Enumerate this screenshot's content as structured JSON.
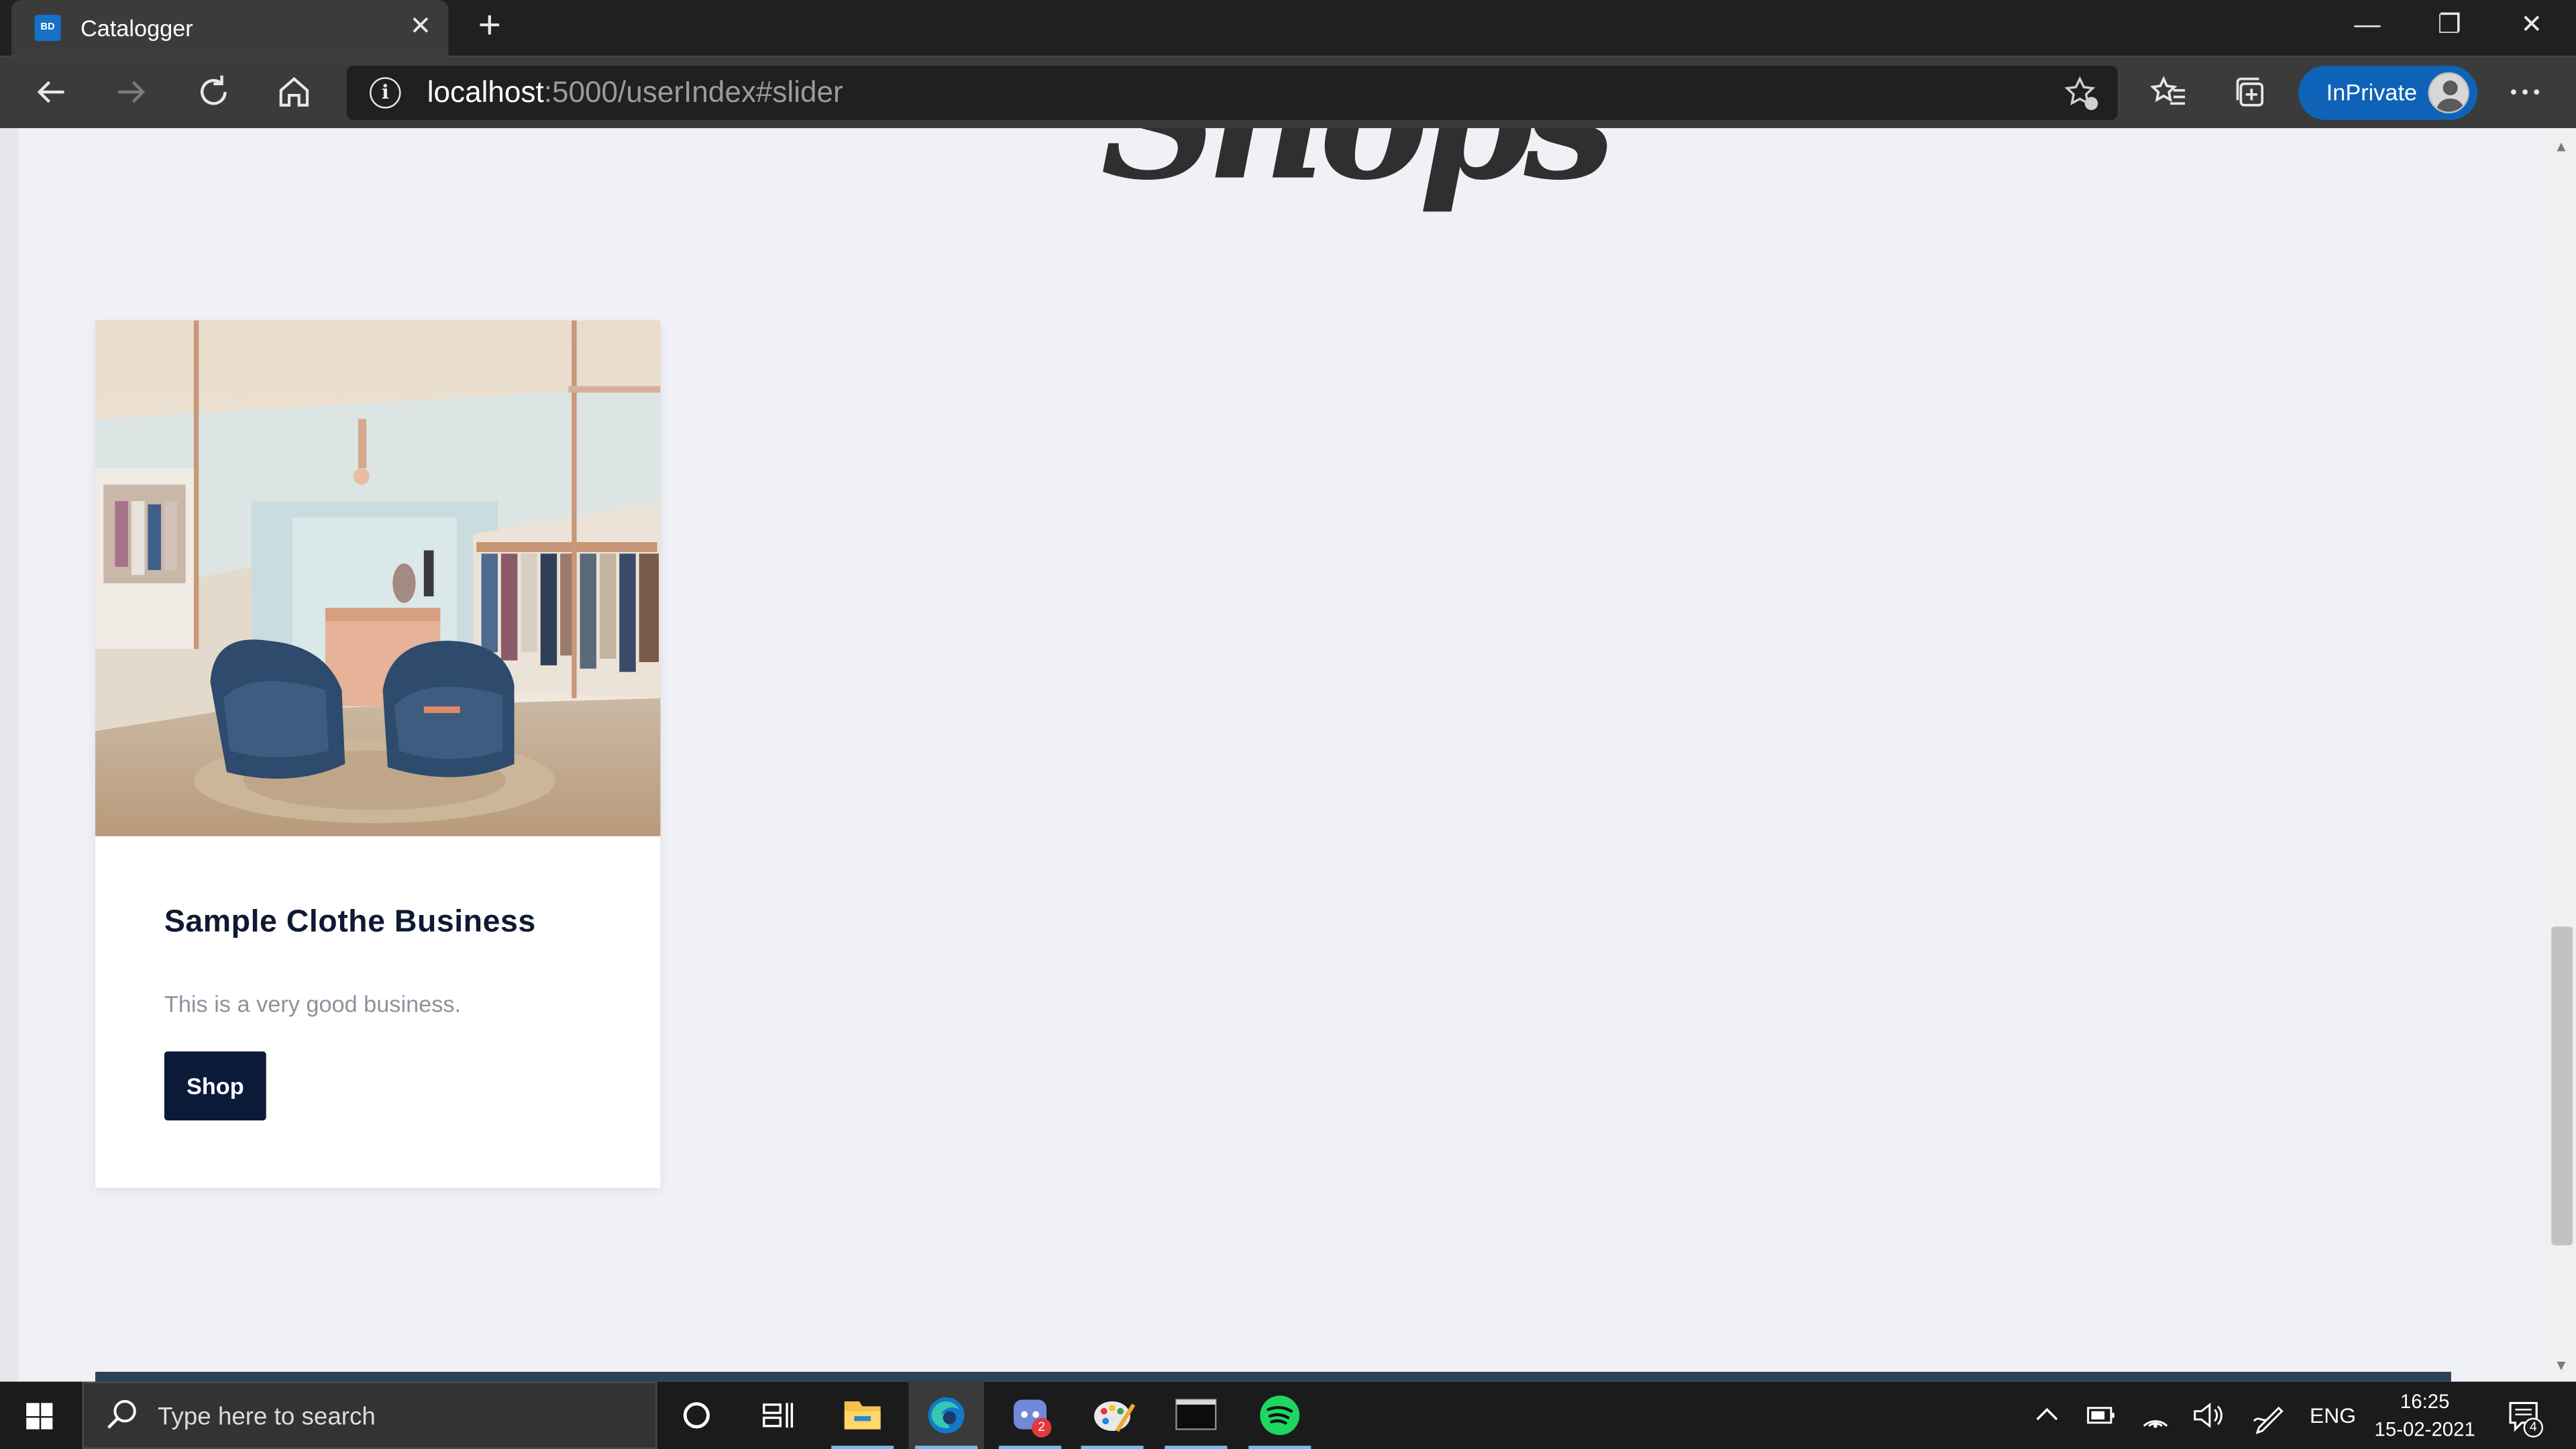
{
  "browser": {
    "tab": {
      "favicon_text": "BD",
      "title": "Catalogger",
      "close_glyph": "✕"
    },
    "new_tab_glyph": "+",
    "window_controls": {
      "minimize": "—",
      "restore": "❐",
      "close": "✕"
    },
    "address": {
      "host": "localhost",
      "rest": ":5000/userIndex#slider"
    },
    "inprivate_label": "InPrivate",
    "icons": {
      "back": "arrow-left-icon",
      "forward": "arrow-right-icon",
      "refresh": "refresh-icon",
      "home": "home-icon",
      "site_info": "info-icon",
      "add_favorite": "star-plus-icon",
      "favorites": "favorites-icon",
      "collections": "collections-icon",
      "menu": "ellipsis-icon"
    }
  },
  "page": {
    "heading_fragment": "Shops",
    "card": {
      "title": "Sample Clothe Business",
      "description": "This is a very good business.",
      "button_label": "Shop"
    },
    "colors": {
      "background": "#f0f1f6",
      "button": "#0c1a3a",
      "title": "#0e1a33",
      "footer_band": "#2d4257"
    }
  },
  "taskbar": {
    "search_placeholder": "Type here to search",
    "apps": [
      "cortana-icon",
      "task-view-icon",
      "file-explorer-icon",
      "edge-icon",
      "discord-icon",
      "paint-icon",
      "terminal-icon",
      "spotify-icon"
    ],
    "discord_badge": "2",
    "language": "ENG",
    "time": "16:25",
    "date": "15-02-2021",
    "notifications_badge": "4"
  }
}
